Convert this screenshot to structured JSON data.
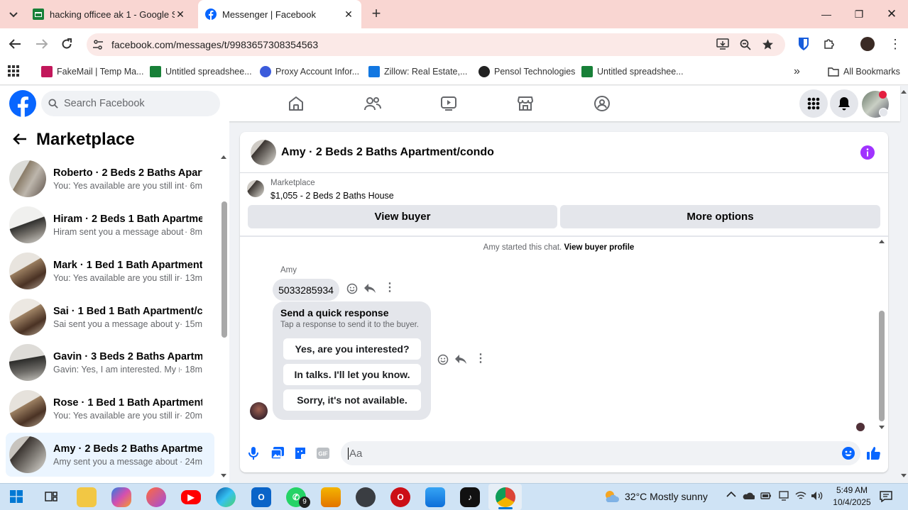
{
  "browser": {
    "tabs": [
      {
        "title": "hacking officee ak 1 - Google Sl"
      },
      {
        "title": "Messenger | Facebook"
      }
    ],
    "url": "facebook.com/messages/t/9983657308354563",
    "bookmarks": [
      {
        "label": "FakeMail | Temp Ma...",
        "color": "#c2185b"
      },
      {
        "label": "Untitled spreadshee...",
        "color": "#188038"
      },
      {
        "label": "Proxy Account Infor...",
        "color": "#3b5bdb"
      },
      {
        "label": "Zillow: Real Estate,...",
        "color": "#1277e1"
      },
      {
        "label": "Pensol Technologies",
        "color": "#222222"
      },
      {
        "label": "Untitled spreadshee...",
        "color": "#188038"
      }
    ],
    "all_bookmarks": "All Bookmarks"
  },
  "fb": {
    "search_placeholder": "Search Facebook",
    "brand_color": "#0866ff"
  },
  "sidebar": {
    "title": "Marketplace",
    "conversations": [
      {
        "name": "Roberto · 2 Beds 2 Baths Apart...",
        "preview": "You: Yes available are you still inter...",
        "time": "· 6m"
      },
      {
        "name": "Hiram · 2 Beds 1 Bath Apartmen...",
        "preview": "Hiram sent you a message about y...",
        "time": "· 8m"
      },
      {
        "name": "Mark · 1 Bed 1 Bath Apartment/...",
        "preview": "You: Yes available are you still int...",
        "time": "· 13m"
      },
      {
        "name": "Sai · 1 Bed 1 Bath Apartment/co...",
        "preview": "Sai sent you a message about yo...",
        "time": "· 15m"
      },
      {
        "name": "Gavin · 3 Beds 2 Baths Apartme...",
        "preview": "Gavin: Yes, I am interested. My n...",
        "time": "· 18m"
      },
      {
        "name": "Rose · 1 Bed 1 Bath Apartment/c...",
        "preview": "You: Yes available are you still int...",
        "time": "· 20m"
      },
      {
        "name": "Amy · 2 Beds 2 Baths Apartmen...",
        "preview": "Amy sent you a message about y...",
        "time": "· 24m"
      }
    ]
  },
  "chat": {
    "title": "Amy · 2 Beds 2 Baths Apartment/condo",
    "listing_label": "Marketplace",
    "listing_title": "$1,055 - 2 Beds 2 Baths House",
    "view_buyer": "View buyer",
    "more_options": "More options",
    "started_text": "Amy started this chat.",
    "view_profile": "View buyer profile",
    "sender": "Amy",
    "message": "5033285934",
    "quick_title": "Send a quick response",
    "quick_sub": "Tap a response to send it to the buyer.",
    "quick_responses": [
      "Yes, are you interested?",
      "In talks. I'll let you know.",
      "Sorry, it's not available."
    ],
    "compose_placeholder": "Aa"
  },
  "taskbar": {
    "weather": "32°C  Mostly sunny",
    "time": "5:49 AM",
    "date": "10/4/2025",
    "whatsapp_badge": "9"
  }
}
